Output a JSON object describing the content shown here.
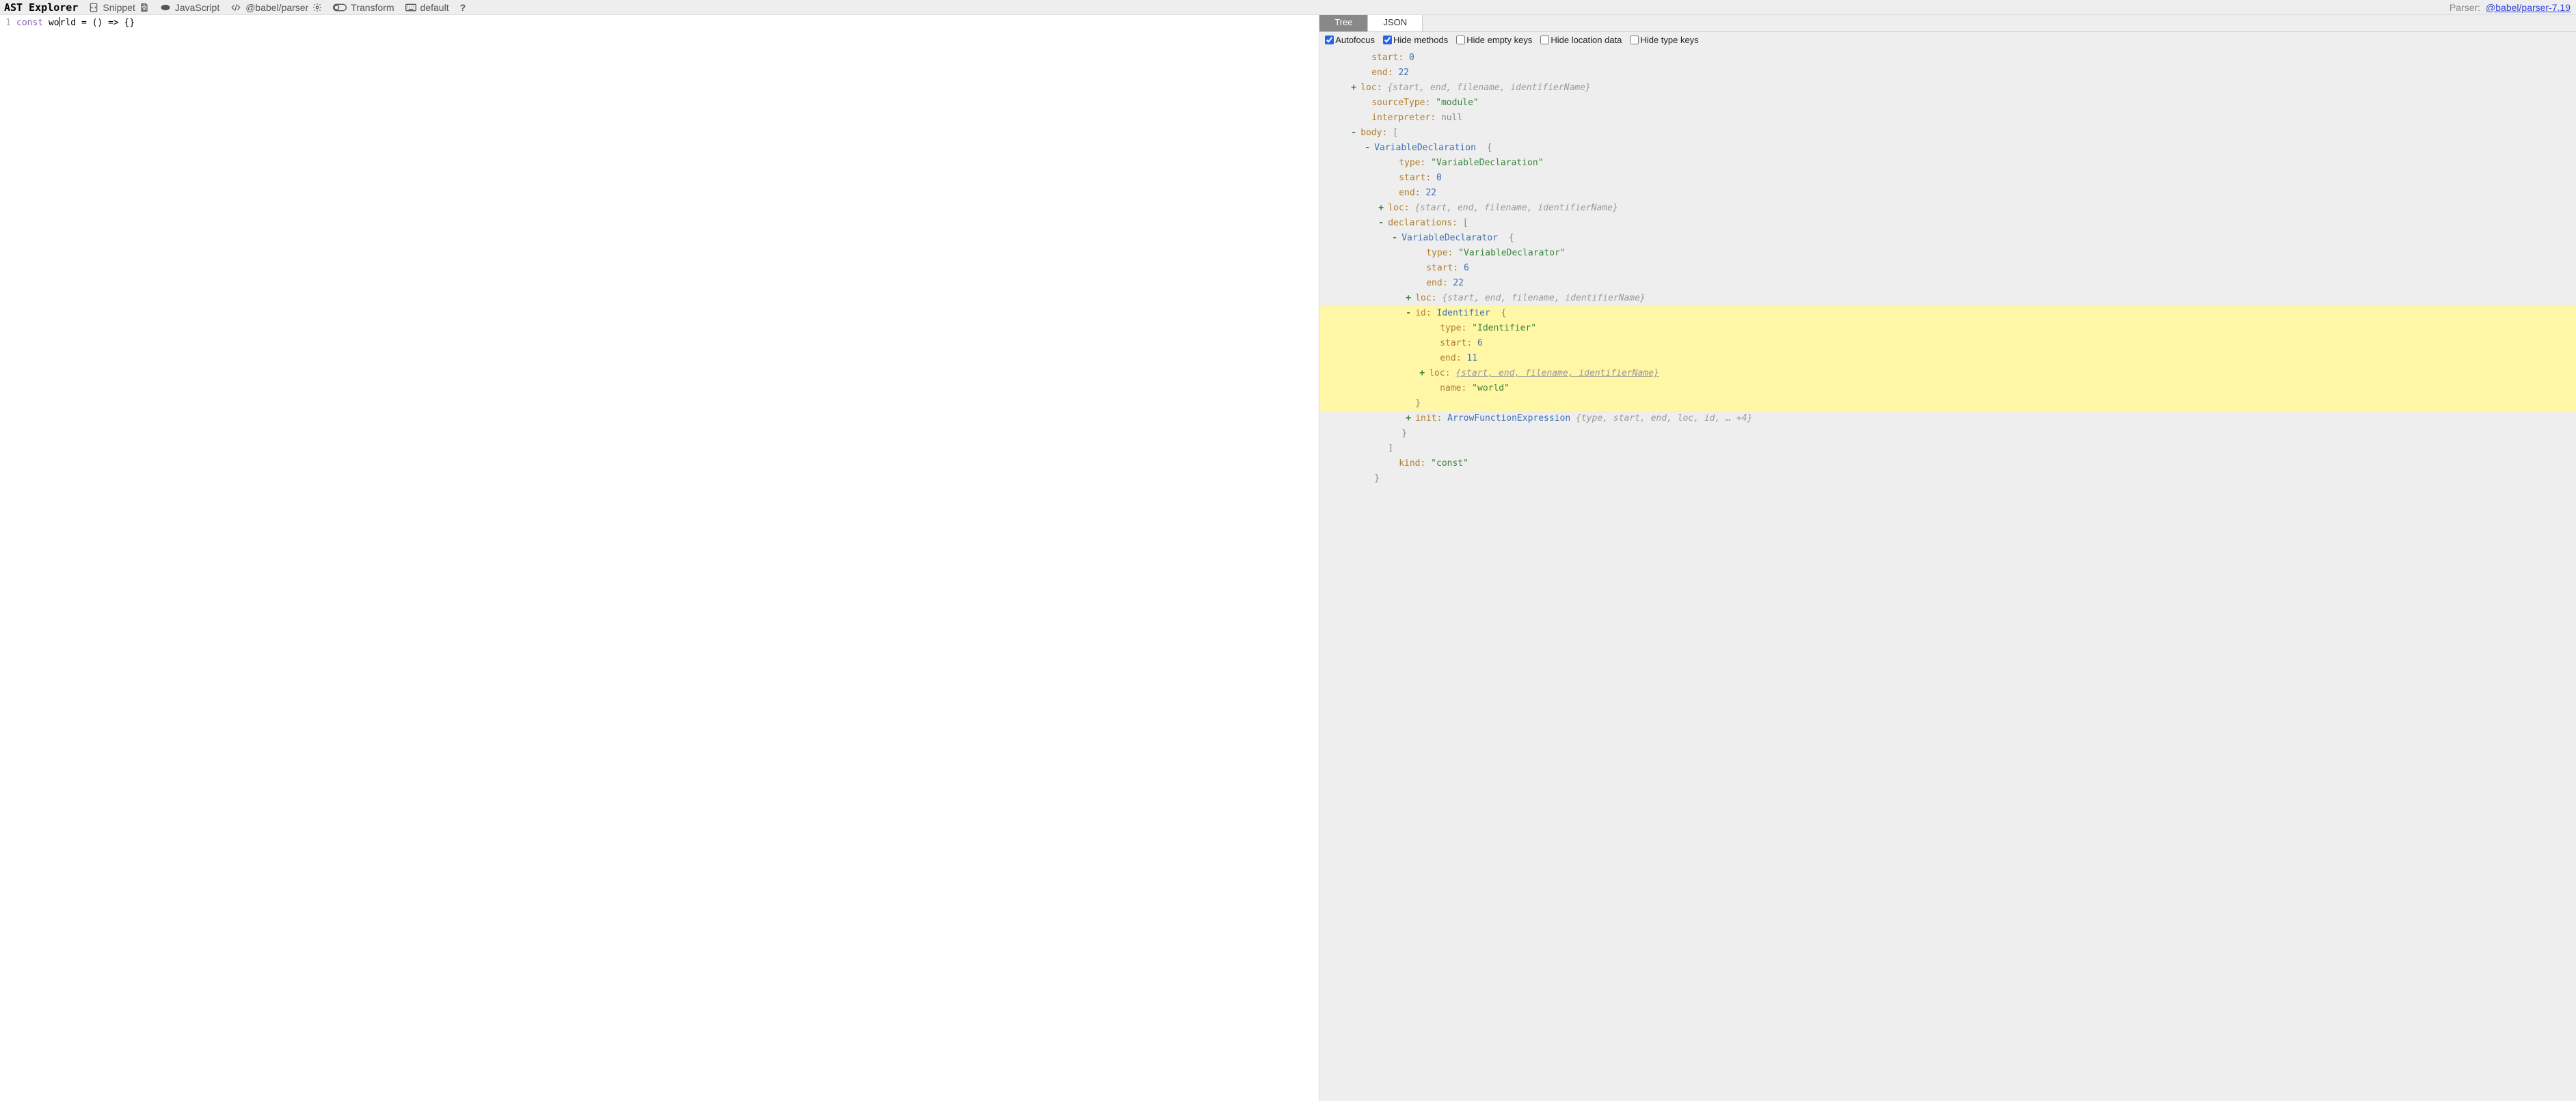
{
  "toolbar": {
    "brand": "AST Explorer",
    "snippet": "Snippet",
    "language": "JavaScript",
    "parser": "@babel/parser",
    "transform": "Transform",
    "keymap": "default",
    "parser_label": "Parser:",
    "parser_link": "@babel/parser-7.19"
  },
  "code": {
    "line_number": "1",
    "kw": "const",
    "name_before": " wo",
    "name_after": "rld ",
    "eq": "=",
    "parens": " () ",
    "arrow": "=>",
    "braces": " {}"
  },
  "tabs": {
    "tree": "Tree",
    "json": "JSON"
  },
  "options": {
    "autofocus": "Autofocus",
    "hide_methods": "Hide methods",
    "hide_empty": "Hide empty keys",
    "hide_location": "Hide location data",
    "hide_type": "Hide type keys"
  },
  "ast": {
    "start_k": "start",
    "start_v": "0",
    "end_k": "end",
    "end_v": "22",
    "loc_k": "loc",
    "loc_ph": "{start, end, filename, identifierName}",
    "sourceType_k": "sourceType",
    "sourceType_v": "\"module\"",
    "interpreter_k": "interpreter",
    "interpreter_v": "null",
    "body_k": "body",
    "body_open": "[",
    "vd_type": "VariableDeclaration",
    "vd_open": "{",
    "vd_type_k": "type",
    "vd_type_v": "\"VariableDeclaration\"",
    "vd_start_k": "start",
    "vd_start_v": "0",
    "vd_end_k": "end",
    "vd_end_v": "22",
    "vd_loc_k": "loc",
    "vd_loc_ph": "{start, end, filename, identifierName}",
    "decls_k": "declarations",
    "decls_open": "[",
    "vr_type": "VariableDeclarator",
    "vr_open": "{",
    "vr_type_k": "type",
    "vr_type_v": "\"VariableDeclarator\"",
    "vr_start_k": "start",
    "vr_start_v": "6",
    "vr_end_k": "end",
    "vr_end_v": "22",
    "vr_loc_k": "loc",
    "vr_loc_ph": "{start, end, filename, identifierName}",
    "id_k": "id",
    "id_type": "Identifier",
    "id_open": "{",
    "id_type_k": "type",
    "id_type_v": "\"Identifier\"",
    "id_start_k": "start",
    "id_start_v": "6",
    "id_end_k": "end",
    "id_end_v": "11",
    "id_loc_k": "loc",
    "id_loc_ph": "{start, end, filename, identifierName}",
    "id_name_k": "name",
    "id_name_v": "\"world\"",
    "id_close": "}",
    "init_k": "init",
    "init_type": "ArrowFunctionExpression",
    "init_ph": "{type, start, end, loc, id, … +4}",
    "vr_close": "}",
    "decls_close": "]",
    "kind_k": "kind",
    "kind_v": "\"const\"",
    "vd_close": "}"
  }
}
